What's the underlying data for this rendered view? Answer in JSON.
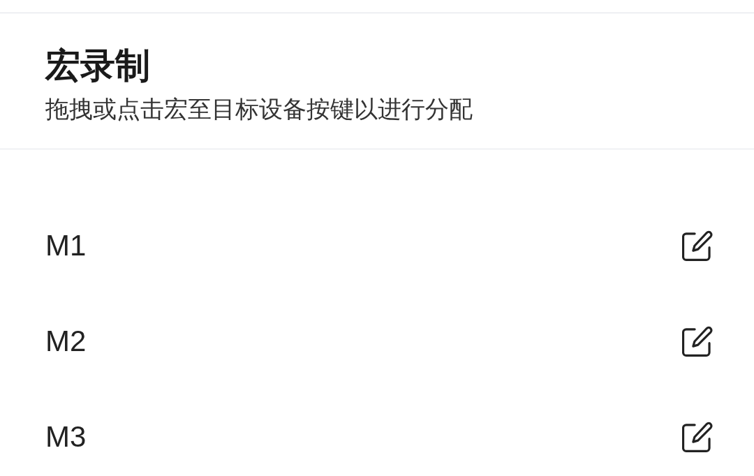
{
  "header": {
    "title": "宏录制",
    "subtitle": "拖拽或点击宏至目标设备按键以进行分配"
  },
  "macros": [
    {
      "name": "M1"
    },
    {
      "name": "M2"
    },
    {
      "name": "M3"
    }
  ]
}
